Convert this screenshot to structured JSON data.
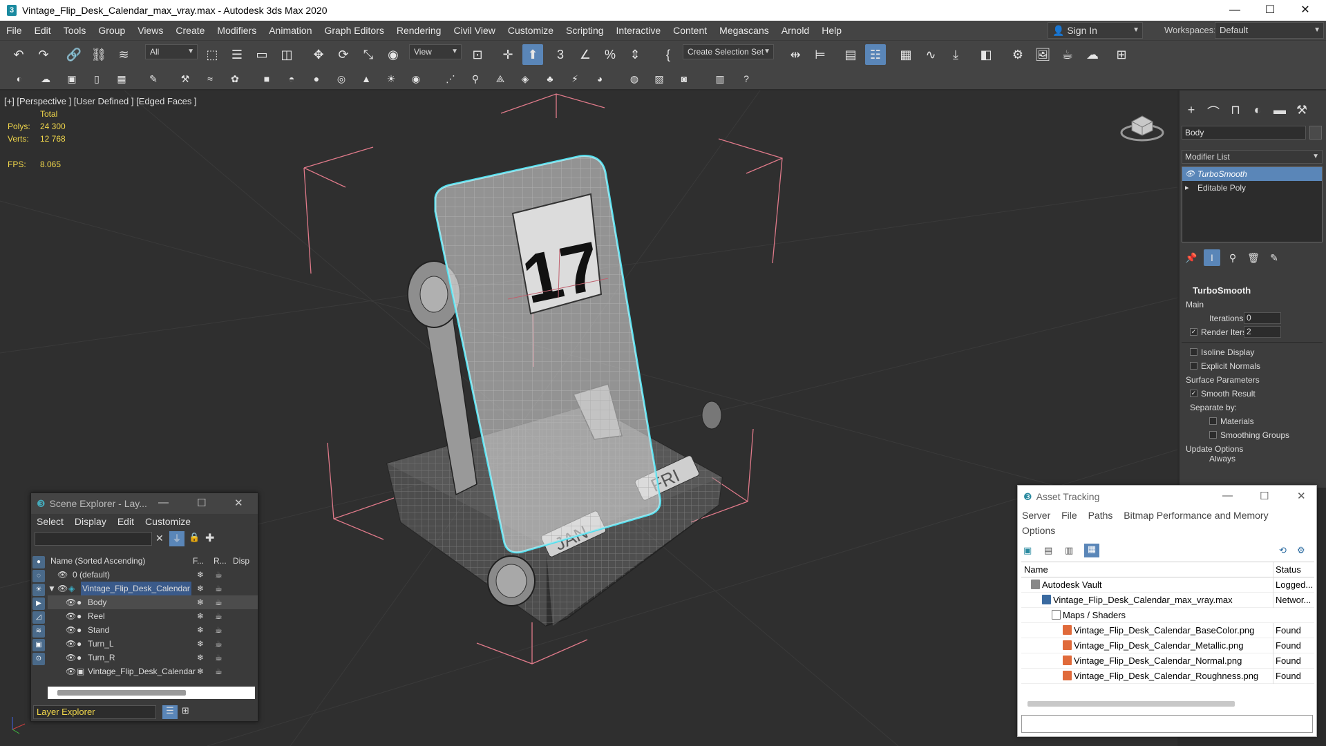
{
  "window": {
    "title": "Vintage_Flip_Desk_Calendar_max_vray.max - Autodesk 3ds Max 2020",
    "minimize": "—",
    "maximize": "☐",
    "close": "✕"
  },
  "menu": [
    "File",
    "Edit",
    "Tools",
    "Group",
    "Views",
    "Create",
    "Modifiers",
    "Animation",
    "Graph Editors",
    "Rendering",
    "Civil View",
    "Customize",
    "Scripting",
    "Interactive",
    "Content",
    "Megascans",
    "Arnold",
    "Help"
  ],
  "signin": "Sign In",
  "workspaces": {
    "label": "Workspaces:",
    "value": "Default"
  },
  "toolbar": {
    "filter": "All",
    "refcoord": "View",
    "selection_set": "Create Selection Set"
  },
  "viewport": {
    "label": "[+] [Perspective ] [User Defined ] [Edged Faces ]",
    "stats": {
      "total_label": "Total",
      "polys_label": "Polys:",
      "polys": "24 300",
      "verts_label": "Verts:",
      "verts": "12 768",
      "fps_label": "FPS:",
      "fps": "8.065"
    },
    "model_text": {
      "day": "17",
      "month": "JAN",
      "weekday": "FRI"
    },
    "colors": {
      "selection": "#4fe0f0",
      "bbox": "#e07a8a",
      "stats": "#f2d84b"
    }
  },
  "command_panel": {
    "object_name": "Body",
    "modifier_list": "Modifier List",
    "stack": [
      "TurboSmooth",
      "Editable Poly"
    ],
    "rollout_title": "TurboSmooth",
    "main_label": "Main",
    "iterations_label": "Iterations:",
    "iterations": "0",
    "render_iters_label": "Render Iters:",
    "render_iters": "2",
    "isoline": "Isoline Display",
    "explicit_normals": "Explicit Normals",
    "surface_params": "Surface Parameters",
    "smooth_result": "Smooth Result",
    "separate_by": "Separate by:",
    "materials": "Materials",
    "smoothing_groups": "Smoothing Groups",
    "update_options": "Update Options",
    "always": "Always"
  },
  "scene_explorer": {
    "title": "Scene Explorer - Lay...",
    "menu": [
      "Select",
      "Display",
      "Edit",
      "Customize"
    ],
    "header": {
      "name": "Name (Sorted Ascending)",
      "f": "F...",
      "r": "R...",
      "d": "Disp"
    },
    "rows": [
      {
        "name": "0 (default)",
        "level": 0
      },
      {
        "name": "Vintage_Flip_Desk_Calendar",
        "level": 0
      },
      {
        "name": "Body",
        "level": 1
      },
      {
        "name": "Reel",
        "level": 1
      },
      {
        "name": "Stand",
        "level": 1
      },
      {
        "name": "Turn_L",
        "level": 1
      },
      {
        "name": "Turn_R",
        "level": 1
      },
      {
        "name": "Vintage_Flip_Desk_Calendar",
        "level": 1
      }
    ],
    "footer": "Layer Explorer"
  },
  "asset_tracking": {
    "title": "Asset Tracking",
    "menu": [
      "Server",
      "File",
      "Paths",
      "Bitmap Performance and Memory"
    ],
    "menu2": "Options",
    "columns": {
      "name": "Name",
      "status": "Status"
    },
    "rows": [
      {
        "name": "Autodesk Vault",
        "status": "Logged..."
      },
      {
        "name": "Vintage_Flip_Desk_Calendar_max_vray.max",
        "status": "Networ..."
      },
      {
        "name": "Maps / Shaders",
        "status": ""
      },
      {
        "name": "Vintage_Flip_Desk_Calendar_BaseColor.png",
        "status": "Found"
      },
      {
        "name": "Vintage_Flip_Desk_Calendar_Metallic.png",
        "status": "Found"
      },
      {
        "name": "Vintage_Flip_Desk_Calendar_Normal.png",
        "status": "Found"
      },
      {
        "name": "Vintage_Flip_Desk_Calendar_Roughness.png",
        "status": "Found"
      }
    ]
  }
}
